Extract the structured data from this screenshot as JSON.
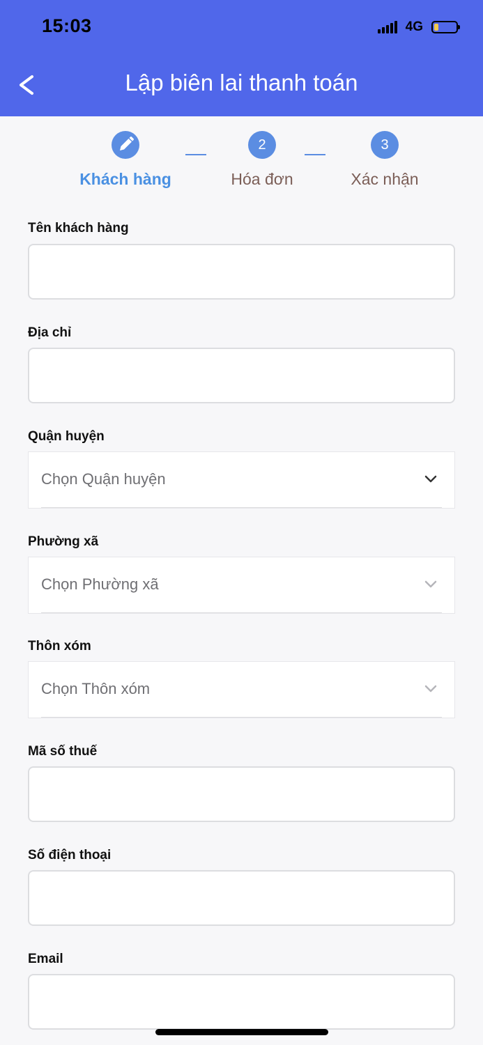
{
  "status_bar": {
    "time": "15:03",
    "network": "4G",
    "battery_level": 0.2
  },
  "header": {
    "title": "Lập biên lai thanh toán",
    "back_icon": "chevron-left-icon"
  },
  "stepper": {
    "active_color": "#4a90e2",
    "inactive_color": "#7b5e57",
    "steps": [
      {
        "number": "",
        "icon": "pencil-icon",
        "label": "Khách hàng",
        "active": true
      },
      {
        "number": "2",
        "label": "Hóa đơn",
        "active": false
      },
      {
        "number": "3",
        "label": "Xác nhận",
        "active": false
      }
    ]
  },
  "form": {
    "customer_name": {
      "label": "Tên khách hàng",
      "value": ""
    },
    "address": {
      "label": "Địa chỉ",
      "value": ""
    },
    "district": {
      "label": "Quận huyện",
      "placeholder": "Chọn Quận huyện"
    },
    "ward": {
      "label": "Phường xã",
      "placeholder": "Chọn Phường xã"
    },
    "village": {
      "label": "Thôn xóm",
      "placeholder": "Chọn Thôn xóm"
    },
    "tax_code": {
      "label": "Mã số thuế",
      "value": ""
    },
    "phone": {
      "label": "Số điện thoại",
      "value": ""
    },
    "email": {
      "label": "Email",
      "value": ""
    }
  },
  "colors": {
    "header_bg": "#5067ea",
    "step_circle": "#5b8de2"
  }
}
